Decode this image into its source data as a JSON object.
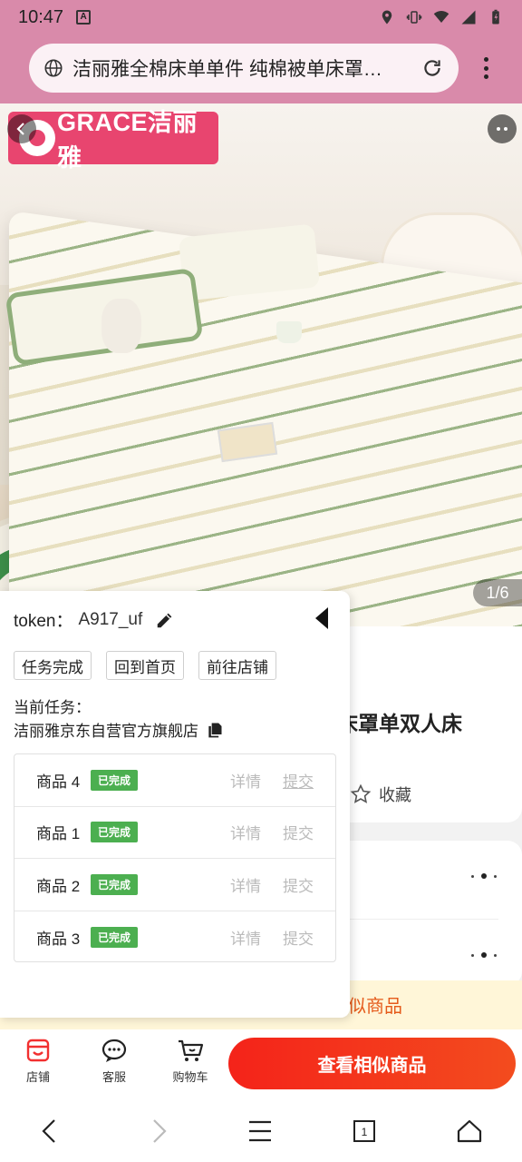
{
  "status_bar": {
    "time": "10:47",
    "app_badge": "A"
  },
  "browser": {
    "url_text": "洁丽雅全棉床单单件 纯棉被单床罩…"
  },
  "hero": {
    "brand_logo_text": "GRACE洁丽雅",
    "pager": "1/6"
  },
  "product": {
    "title_partial": "床罩单双人床",
    "favorite_label": "收藏",
    "similar_strip": "似商品"
  },
  "panel": {
    "token_label": "token：",
    "token_value": "A917_uf",
    "buttons": [
      "任务完成",
      "回到首页",
      "前往店铺"
    ],
    "task_label": "当前任务：",
    "task_shop": "洁丽雅京东自营官方旗舰店",
    "rows": [
      {
        "name": "商品 4",
        "badge": "已完成",
        "detail": "详情",
        "submit": "提交"
      },
      {
        "name": "商品 1",
        "badge": "已完成",
        "detail": "详情",
        "submit": "提交"
      },
      {
        "name": "商品 2",
        "badge": "已完成",
        "detail": "详情",
        "submit": "提交"
      },
      {
        "name": "商品 3",
        "badge": "已完成",
        "detail": "详情",
        "submit": "提交"
      }
    ]
  },
  "action_bar": {
    "shop": "店铺",
    "service": "客服",
    "cart": "购物车",
    "cta": "查看相似商品"
  },
  "colors": {
    "status_bar": "#d98aaa",
    "cta": "#f4231a",
    "badge": "#4caf50",
    "brand": "#e8456f"
  }
}
